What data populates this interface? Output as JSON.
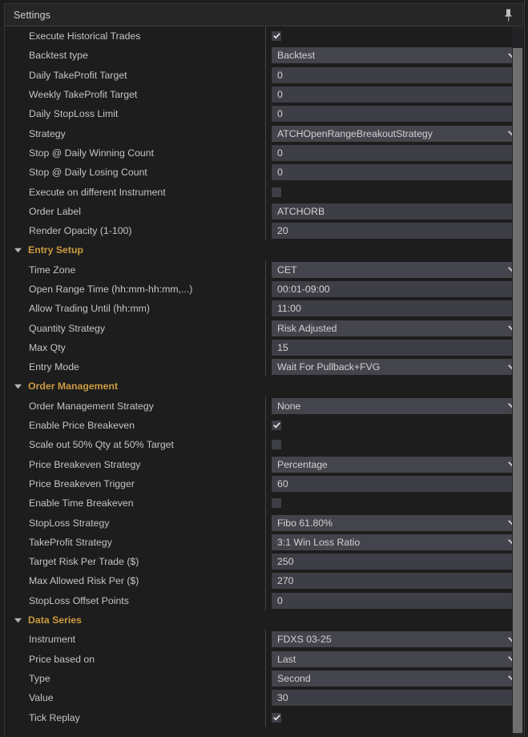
{
  "window": {
    "title": "Settings",
    "pin_icon": "pin-icon",
    "accent_color": "#cc9a3f",
    "field_bg": "#3e3e46",
    "panel_bg": "#1d1d1d"
  },
  "scrollbar": {
    "orientation": "vertical",
    "thumb_top_pct": 3,
    "thumb_height_pct": 96
  },
  "rows": [
    {
      "kind": "row",
      "label": "Execute Historical Trades",
      "type": "checkbox",
      "checked": true
    },
    {
      "kind": "row",
      "label": "Backtest type",
      "type": "combo",
      "value": "Backtest"
    },
    {
      "kind": "row",
      "label": "Daily TakeProfit Target",
      "type": "text",
      "value": "0"
    },
    {
      "kind": "row",
      "label": "Weekly TakeProfit Target",
      "type": "text",
      "value": "0"
    },
    {
      "kind": "row",
      "label": "Daily StopLoss Limit",
      "type": "text",
      "value": "0"
    },
    {
      "kind": "row",
      "label": "Strategy",
      "type": "combo",
      "value": "ATCHOpenRangeBreakoutStrategy"
    },
    {
      "kind": "row",
      "label": "Stop @ Daily Winning Count",
      "type": "text",
      "value": "0"
    },
    {
      "kind": "row",
      "label": "Stop @ Daily Losing Count",
      "type": "text",
      "value": "0"
    },
    {
      "kind": "row",
      "label": "Execute on different Instrument",
      "type": "checkbox",
      "checked": false
    },
    {
      "kind": "row",
      "label": "Order Label",
      "type": "text",
      "value": "ATCHORB"
    },
    {
      "kind": "row",
      "label": "Render Opacity (1-100)",
      "type": "text",
      "value": "20"
    },
    {
      "kind": "section",
      "label": "Entry Setup",
      "expanded": true
    },
    {
      "kind": "row",
      "label": "Time Zone",
      "type": "combo",
      "value": "CET"
    },
    {
      "kind": "row",
      "label": "Open Range Time (hh:mm-hh:mm,...)",
      "type": "text",
      "value": "00:01-09:00"
    },
    {
      "kind": "row",
      "label": "Allow Trading Until (hh:mm)",
      "type": "text",
      "value": "11:00"
    },
    {
      "kind": "row",
      "label": "Quantity Strategy",
      "type": "combo",
      "value": "Risk Adjusted"
    },
    {
      "kind": "row",
      "label": "Max Qty",
      "type": "text",
      "value": "15"
    },
    {
      "kind": "row",
      "label": "Entry Mode",
      "type": "combo",
      "value": "Wait For Pullback+FVG"
    },
    {
      "kind": "section",
      "label": "Order Management",
      "expanded": true
    },
    {
      "kind": "row",
      "label": "Order Management Strategy",
      "type": "combo",
      "value": "None"
    },
    {
      "kind": "row",
      "label": "Enable Price Breakeven",
      "type": "checkbox",
      "checked": true
    },
    {
      "kind": "row",
      "label": "Scale out 50% Qty at 50% Target",
      "type": "checkbox",
      "checked": false
    },
    {
      "kind": "row",
      "label": "Price Breakeven Strategy",
      "type": "combo",
      "value": "Percentage"
    },
    {
      "kind": "row",
      "label": "Price Breakeven Trigger",
      "type": "text",
      "value": "60"
    },
    {
      "kind": "row",
      "label": "Enable Time Breakeven",
      "type": "checkbox",
      "checked": false
    },
    {
      "kind": "row",
      "label": "StopLoss Strategy",
      "type": "combo",
      "value": "Fibo 61.80%"
    },
    {
      "kind": "row",
      "label": "TakeProfit Strategy",
      "type": "combo",
      "value": "3:1 Win Loss Ratio"
    },
    {
      "kind": "row",
      "label": "Target Risk Per Trade ($)",
      "type": "text",
      "value": "250"
    },
    {
      "kind": "row",
      "label": "Max Allowed Risk Per ($)",
      "type": "text",
      "value": "270"
    },
    {
      "kind": "row",
      "label": "StopLoss Offset Points",
      "type": "text",
      "value": "0"
    },
    {
      "kind": "section",
      "label": "Data Series",
      "expanded": true
    },
    {
      "kind": "row",
      "label": "Instrument",
      "type": "combo",
      "value": "FDXS 03-25"
    },
    {
      "kind": "row",
      "label": "Price based on",
      "type": "combo",
      "value": "Last"
    },
    {
      "kind": "row",
      "label": "Type",
      "type": "combo",
      "value": "Second"
    },
    {
      "kind": "row",
      "label": "Value",
      "type": "text",
      "value": "30"
    },
    {
      "kind": "row",
      "label": "Tick Replay",
      "type": "checkbox",
      "checked": true
    }
  ]
}
